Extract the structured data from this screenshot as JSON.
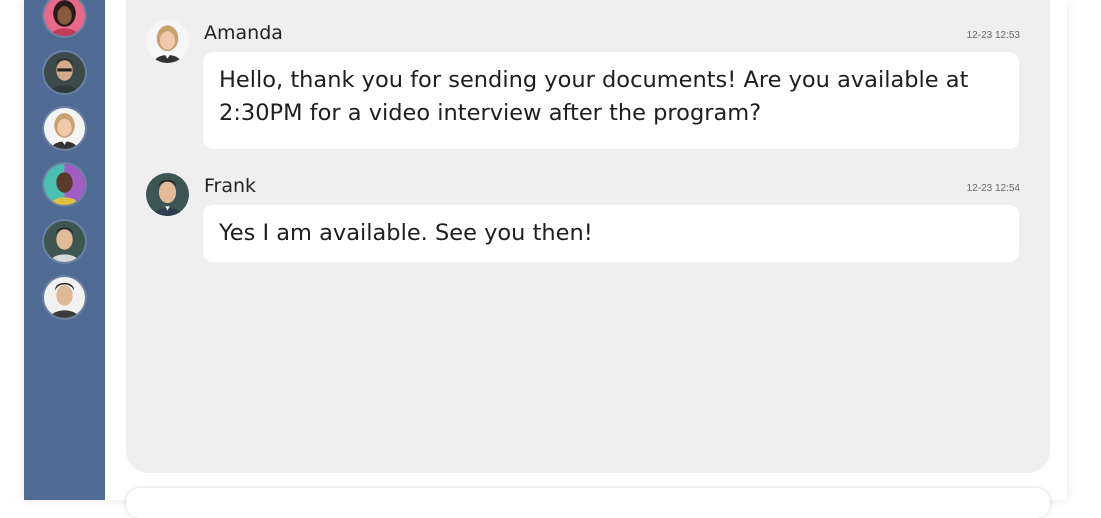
{
  "sidebar": {
    "contacts": [
      {
        "name": "contact-avatar-1"
      },
      {
        "name": "contact-avatar-2"
      },
      {
        "name": "contact-avatar-amanda"
      },
      {
        "name": "contact-avatar-4"
      },
      {
        "name": "contact-avatar-5"
      },
      {
        "name": "contact-avatar-6"
      }
    ]
  },
  "messages": [
    {
      "sender": "Amanda",
      "timestamp": "12-23 12:53",
      "text": "Hello, thank you for sending your documents! Are you available at 2:30PM for a video interview after the program?"
    },
    {
      "sender": "Frank",
      "timestamp": "12-23 12:54",
      "text": "Yes I am available. See you then!"
    }
  ],
  "composer": {
    "placeholder": ""
  },
  "colors": {
    "sidebar": "#4f6b93",
    "chat_background": "#efefef",
    "bubble": "#ffffff"
  }
}
